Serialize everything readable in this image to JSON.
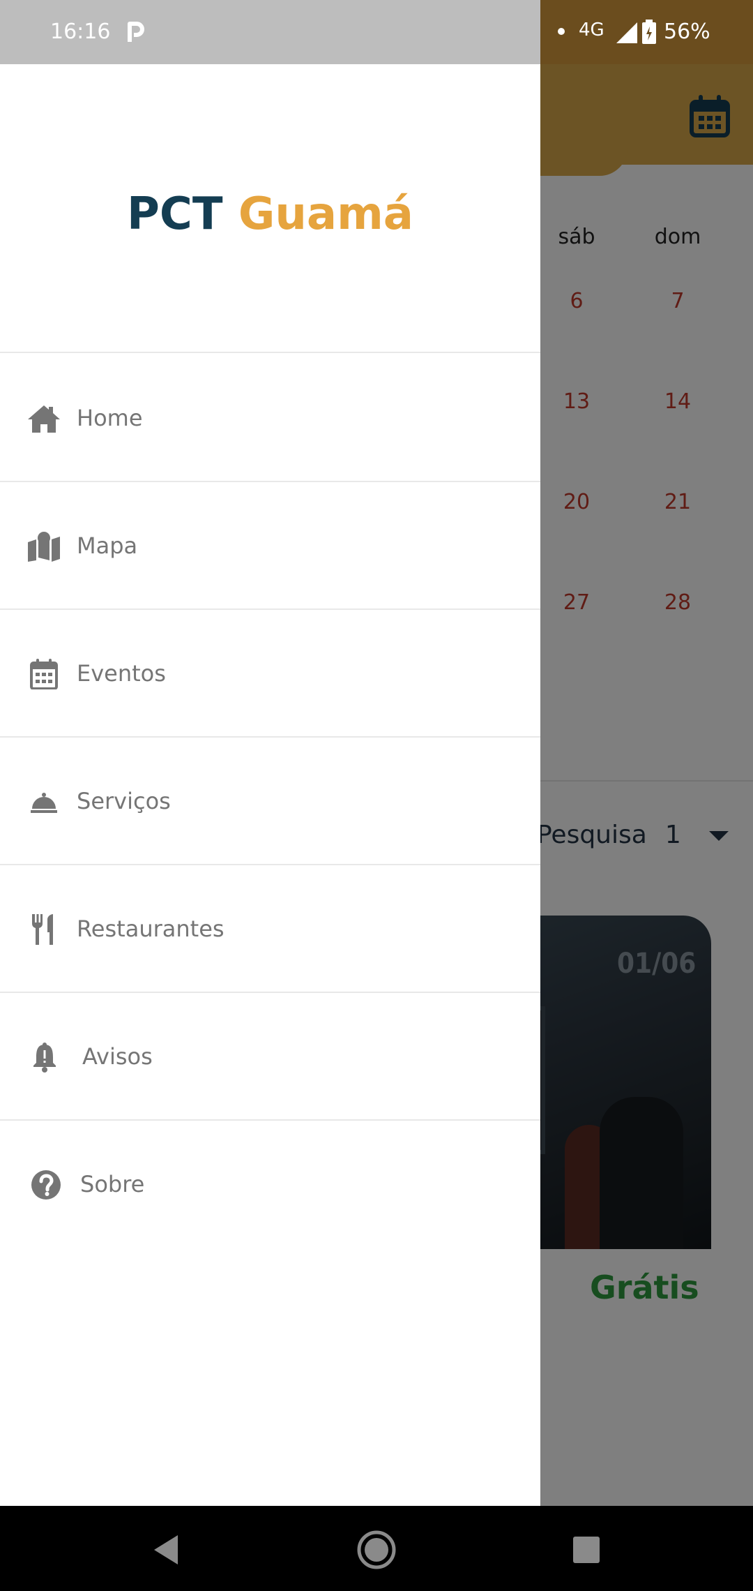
{
  "status_bar": {
    "time": "16:16",
    "network": "4G",
    "battery": "56%"
  },
  "background": {
    "weekdays": [
      "sáb",
      "dom"
    ],
    "weeks": [
      [
        "6",
        "7"
      ],
      [
        "13",
        "14"
      ],
      [
        "20",
        "21"
      ],
      [
        "27",
        "28"
      ]
    ],
    "picker": {
      "label": "Pesquisa",
      "value": "1"
    },
    "card": {
      "badge": "01/06",
      "price": "Grátis"
    },
    "colors": {
      "appbar": "#d9a84a",
      "weekend_day": "#c0392b",
      "price": "#2e9b3e"
    }
  },
  "drawer": {
    "brand_part1": "PCT",
    "brand_part2": "Guamá",
    "items": [
      {
        "label": "Home",
        "icon": "home-icon"
      },
      {
        "label": "Mapa",
        "icon": "map-icon"
      },
      {
        "label": "Eventos",
        "icon": "calendar-icon"
      },
      {
        "label": "Serviços",
        "icon": "room-service-bell-icon"
      },
      {
        "label": "Restaurantes",
        "icon": "fork-knife-icon"
      },
      {
        "label": "Avisos",
        "icon": "bell-alert-icon"
      },
      {
        "label": "Sobre",
        "icon": "help-circle-icon"
      }
    ],
    "colors": {
      "brand_dark": "#143d52",
      "brand_accent": "#e6a43e",
      "item_text": "#757575"
    }
  }
}
